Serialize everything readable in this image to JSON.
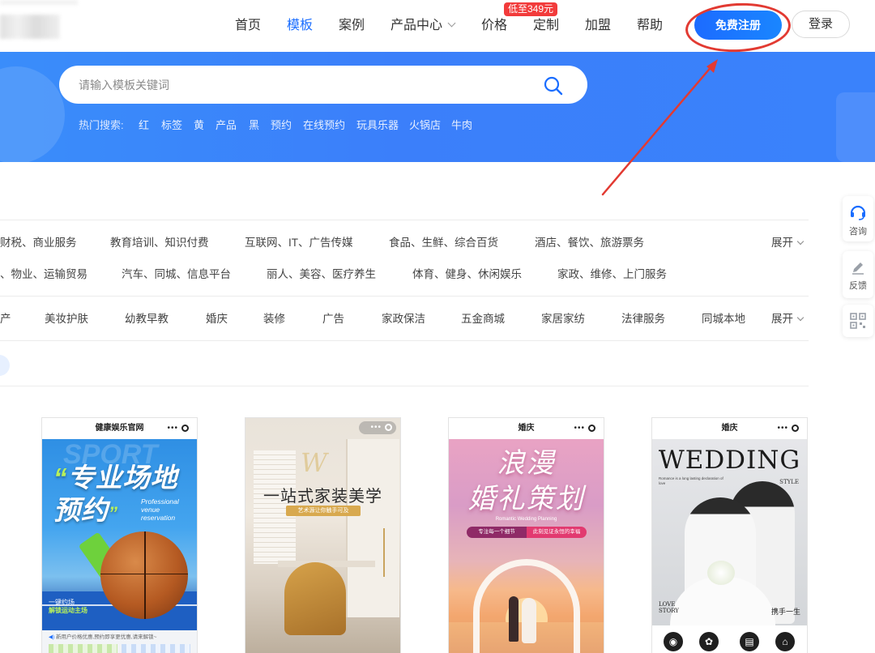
{
  "header": {
    "nav": [
      {
        "label": "首页"
      },
      {
        "label": "模板"
      },
      {
        "label": "案例"
      },
      {
        "label": "产品中心"
      },
      {
        "label": "价格"
      },
      {
        "label": "定制"
      },
      {
        "label": "加盟"
      },
      {
        "label": "帮助"
      }
    ],
    "price_badge": "低至349元",
    "register_label": "免费注册",
    "login_label": "登录"
  },
  "search": {
    "placeholder": "请输入模板关键词",
    "hot_label": "热门搜索:",
    "hot_terms": [
      "红",
      "标签",
      "黄",
      "产品",
      "黑",
      "预约",
      "在线预约",
      "玩具乐器",
      "火锅店",
      "牛肉"
    ]
  },
  "industry_filter": {
    "row1": [
      "财税、商业服务",
      "教育培训、知识付费",
      "互联网、IT、广告传媒",
      "食品、生鲜、综合百货",
      "酒店、餐饮、旅游票务"
    ],
    "row2": [
      "、物业、运输贸易",
      "汽车、同城、信息平台",
      "丽人、美容、医疗养生",
      "体育、健身、休闲娱乐",
      "家政、维修、上门服务"
    ],
    "expand_label": "展开"
  },
  "scene_filter": {
    "items": [
      "产",
      "美妆护肤",
      "幼教早教",
      "婚庆",
      "装修",
      "广告",
      "家政保洁",
      "五金商城",
      "家居家纺",
      "法律服务",
      "同城本地"
    ],
    "expand_label": "展开"
  },
  "side_tools": [
    {
      "label": "咨询",
      "icon": "headset-icon"
    },
    {
      "label": "反馈",
      "icon": "pencil-icon"
    },
    {
      "label": "",
      "icon": "qrcode-icon"
    }
  ],
  "templates": [
    {
      "bar_title": "健康娱乐官网",
      "bg_word": "SPORT",
      "headline_1": "专业场地",
      "headline_2": "预约",
      "english_1": "Professional",
      "english_2": "venue",
      "english_3": "reservation",
      "line_1": "一键约场",
      "line_2": "解锁运动主场",
      "notice": "新用户价格优惠,预约即享更优惠,请来解锁~"
    },
    {
      "bar_title": "",
      "headline": "一站式家装美学",
      "sub": "艺术源让你触手可及"
    },
    {
      "bar_title": "婚庆",
      "headline_1": "浪漫",
      "headline_2": "婚礼策划",
      "english": "Romantic Wedding Planning",
      "pill_1": "专注每一个细节",
      "pill_2": "此刻见证永恒的幸福"
    },
    {
      "bar_title": "婚庆",
      "headline": "WEDDING",
      "small_text": "Romance is a long lasting declaration of love",
      "style": "STYLE",
      "love_1": "LOVE",
      "love_2": "STORY",
      "hand": "携手一生"
    }
  ],
  "colors": {
    "accent": "#1a6dff",
    "banner": "#3b82fa",
    "badge": "#f23b3b",
    "annotation": "#e23a32"
  }
}
